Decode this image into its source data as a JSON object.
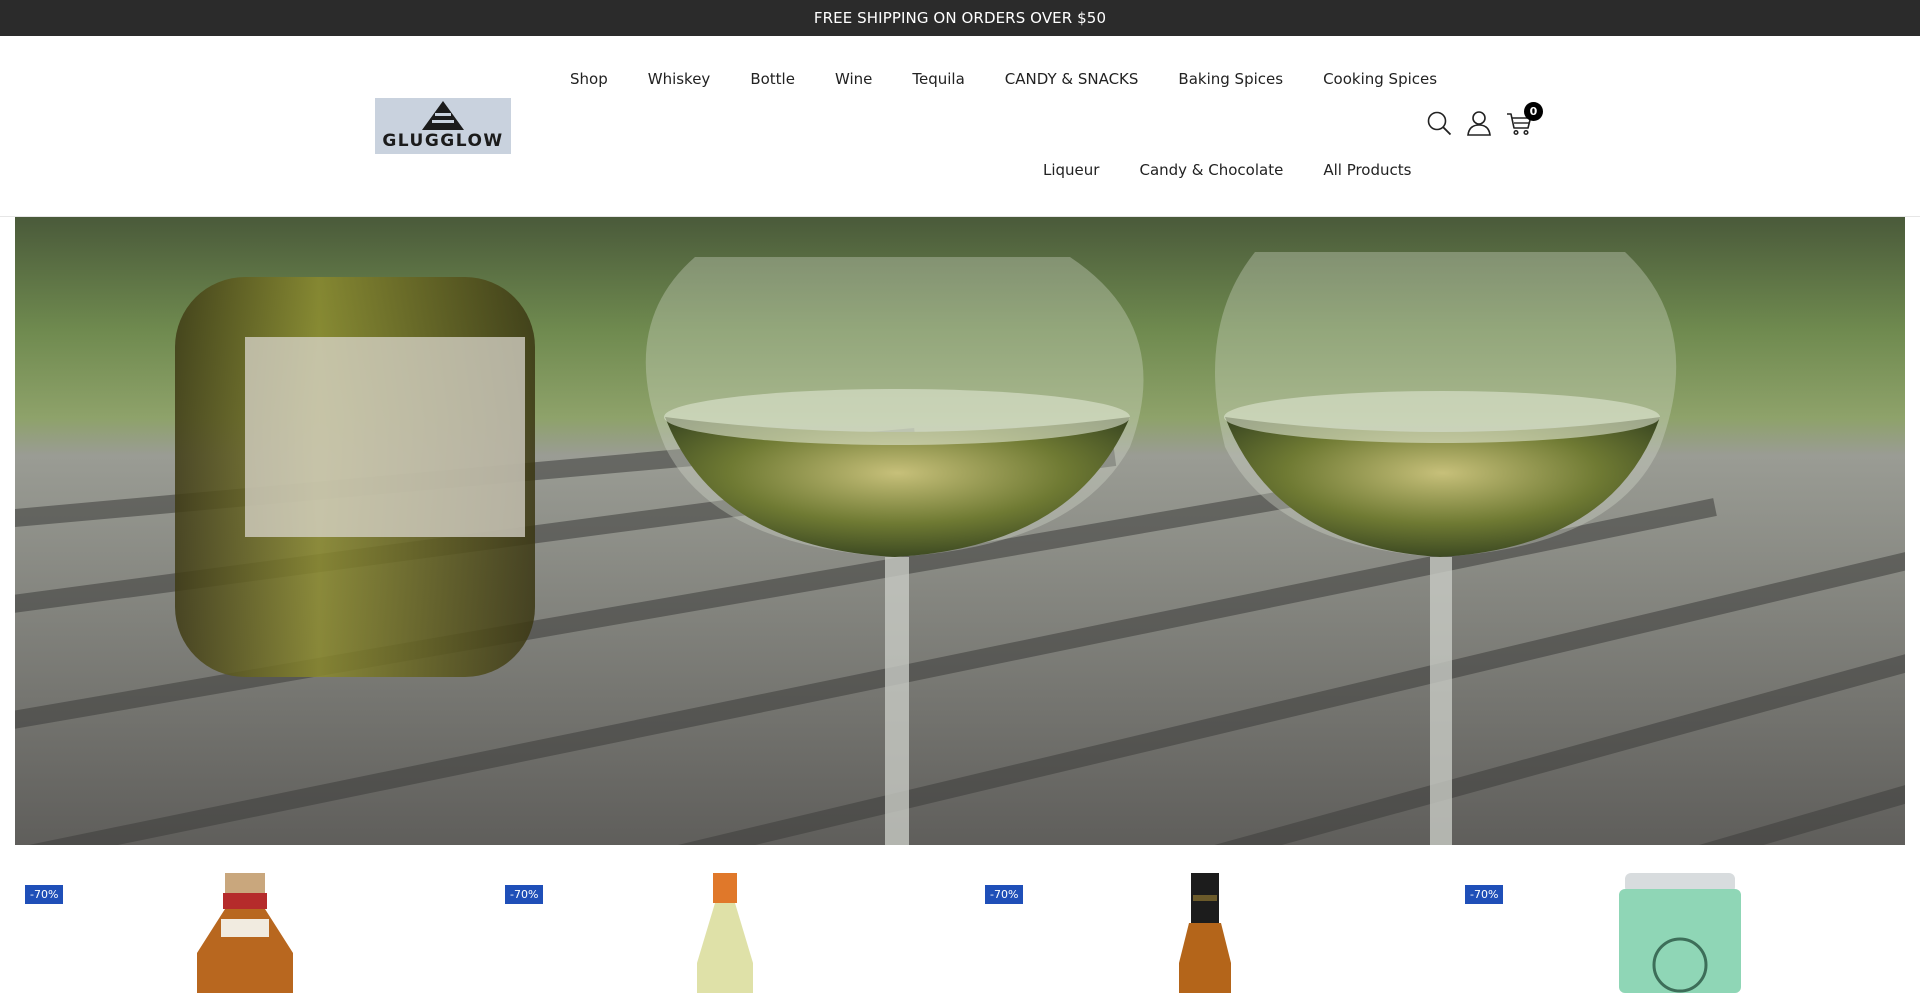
{
  "announcement": "FREE SHIPPING ON ORDERS OVER $50",
  "logo": {
    "text": "GLUGGLOW",
    "bg_color": "#c9d2de"
  },
  "nav": {
    "row1": [
      "Shop",
      "Whiskey",
      "Bottle",
      "Wine",
      "Tequila",
      "CANDY & SNACKS",
      "Baking Spices",
      "Cooking Spices"
    ],
    "row2": [
      "Liqueur",
      "Candy & Chocolate",
      "All Products"
    ]
  },
  "header_icons": {
    "search": "search-icon",
    "account": "user-icon",
    "cart": "cart-icon",
    "cart_count": "0"
  },
  "hero": {
    "description_icon": "wine-glasses-banner"
  },
  "products": [
    {
      "badge": "-70%",
      "image": "whiskey-bottle"
    },
    {
      "badge": "-70%",
      "image": "white-wine-bottle"
    },
    {
      "badge": "-70%",
      "image": "dark-liquor-bottle"
    },
    {
      "badge": "-70%",
      "image": "mint-can"
    }
  ],
  "colors": {
    "announce_bg": "#2b2b2b",
    "badge_bg": "#1f4fb8"
  }
}
